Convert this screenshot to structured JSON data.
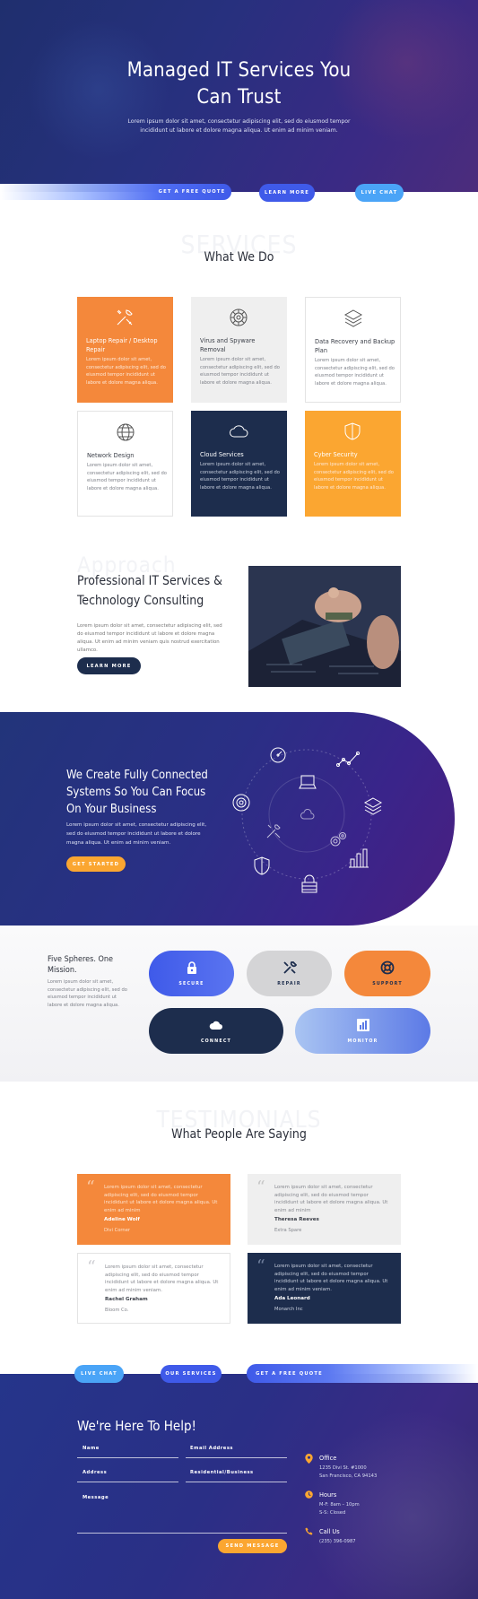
{
  "hero": {
    "title_line1": "Managed IT Services You",
    "title_line2": "Can Trust",
    "subtitle": "Lorem ipsum dolor sit amet, consectetur adipiscing elit, sed do eiusmod tempor incididunt ut labore et dolore magna aliqua. Ut enim ad minim veniam.",
    "buttons": {
      "quote": "Get a Free Quote",
      "learn": "Learn More",
      "chat": "Live Chat"
    }
  },
  "services": {
    "watermark": "SERVICES",
    "title": "What We Do",
    "cards": [
      {
        "icon": "tools-icon",
        "title": "Laptop Repair / Desktop Repair",
        "body": "Lorem ipsum dolor sit amet, consectetur adipiscing elit, sed do eiusmod tempor incididunt ut labore et dolore magna aliqua.",
        "color": "#f4883b"
      },
      {
        "icon": "virus-icon",
        "title": "Virus and Spyware Removal",
        "body": "Lorem ipsum dolor sit amet, consectetur adipiscing elit, sed do eiusmod tempor incididunt ut labore et dolore magna aliqua.",
        "color": "#efefef"
      },
      {
        "icon": "layers-icon",
        "title": "Data Recovery and Backup Plan",
        "body": "Lorem ipsum dolor sit amet, consectetur adipiscing elit, sed do eiusmod tempor incididunt ut labore et dolore magna aliqua.",
        "color": "#ffffff"
      },
      {
        "icon": "globe-icon",
        "title": "Network Design",
        "body": "Lorem ipsum dolor sit amet, consectetur adipiscing elit, sed do eiusmod tempor incididunt ut labore et dolore magna aliqua.",
        "color": "#ffffff"
      },
      {
        "icon": "cloud-icon",
        "title": "Cloud Services",
        "body": "Lorem ipsum dolor sit amet, consectetur adipiscing elit, sed do eiusmod tempor incididunt ut labore et dolore magna aliqua.",
        "color": "#1d2d4d"
      },
      {
        "icon": "shield-icon",
        "title": "Cyber Security",
        "body": "Lorem ipsum dolor sit amet, consectetur adipiscing elit, sed do eiusmod tempor incididunt ut labore et dolore magna aliqua.",
        "color": "#fba631"
      }
    ]
  },
  "approach": {
    "watermark": "Approach",
    "title_line1": "Professional IT Services &",
    "title_line2": "Technology Consulting",
    "body": "Lorem ipsum dolor sit amet, consectetur adipiscing elit, sed do eiusmod tempor incididunt ut labore et dolore magna aliqua. Ut enim ad minim veniam quis nostrud exercitation ullamco.",
    "button": "Learn More"
  },
  "connected": {
    "title_line1": "We Create Fully Connected",
    "title_line2": "Systems So You Can Focus",
    "title_line3": "On Your Business",
    "body": "Lorem ipsum dolor sit amet, consectetur adipiscing elit, sed do eiusmod tempor incididunt ut labore et dolore magna aliqua. Ut enim ad minim veniam.",
    "button": "Get Started"
  },
  "spheres": {
    "title": "Five Spheres. One Mission.",
    "body": "Lorem ipsum dolor sit amet, consectetur adipiscing elit, sed do eiusmod tempor incididunt ut labore et dolore magna aliqua.",
    "items": [
      {
        "label": "SECURE",
        "icon": "lock-icon",
        "color": "#3f5ae9"
      },
      {
        "label": "REPAIR",
        "icon": "tools-icon",
        "color": "#d4d4d6"
      },
      {
        "label": "SUPPORT",
        "icon": "lifebuoy-icon",
        "color": "#f4883b"
      },
      {
        "label": "CONNECT",
        "icon": "cloud-icon",
        "color": "#1d2d4d"
      },
      {
        "label": "MONITOR",
        "icon": "bar-chart-icon",
        "color": "#6f8de0"
      }
    ]
  },
  "testimonials": {
    "watermark": "TESTIMONIALS",
    "title": "What People Are Saying",
    "items": [
      {
        "quote": "Lorem ipsum dolor sit amet, consectetur adipiscing elit, sed do eiusmod tempor incididunt ut labore et dolore magna aliqua. Ut enim ad minim",
        "name": "Adeline Wolf",
        "company": "Divi Corner"
      },
      {
        "quote": "Lorem ipsum dolor sit amet, consectetur adipiscing elit, sed do eiusmod tempor incididunt ut labore et dolore magna aliqua. Ut enim ad minim",
        "name": "Theresa Reeves",
        "company": "Extra Spare"
      },
      {
        "quote": "Lorem ipsum dolor sit amet, consectetur adipiscing elit, sed do eiusmod tempor incididunt ut labore et dolore magna aliqua. Ut enim ad minim veniam.",
        "name": "Rachel Graham",
        "company": "Bloom Co."
      },
      {
        "quote": "Lorem ipsum dolor sit amet, consectetur adipiscing elit, sed do eiusmod tempor incididunt ut labore et dolore magna aliqua. Ut enim ad minim veniam.",
        "name": "Ada Leonard",
        "company": "Monarch Inc"
      }
    ]
  },
  "footer_band": {
    "chat": "Live Chat",
    "services": "Our Services",
    "quote": "Get a Free Quote"
  },
  "contact": {
    "title": "We're Here To Help!",
    "fields": {
      "name": "Name",
      "email": "Email Address",
      "address": "Address",
      "residential": "Residential/Business",
      "message": "Message"
    },
    "send": "Send Message",
    "office_title": "Office",
    "office_line1": "1235 Divi St. #1000",
    "office_line2": "San Francisco, CA 94143",
    "hours_title": "Hours",
    "hours_line1": "M-F: 8am – 10pm",
    "hours_line2": "S-S: Closed",
    "call_title": "Call Us",
    "call_line1": "(235) 396-0987"
  },
  "colors": {
    "navy": "#1d2d4d",
    "blue": "#3f5ae9",
    "orange": "#f4883b",
    "yellow": "#fba631",
    "sky": "#4aa4f7"
  }
}
